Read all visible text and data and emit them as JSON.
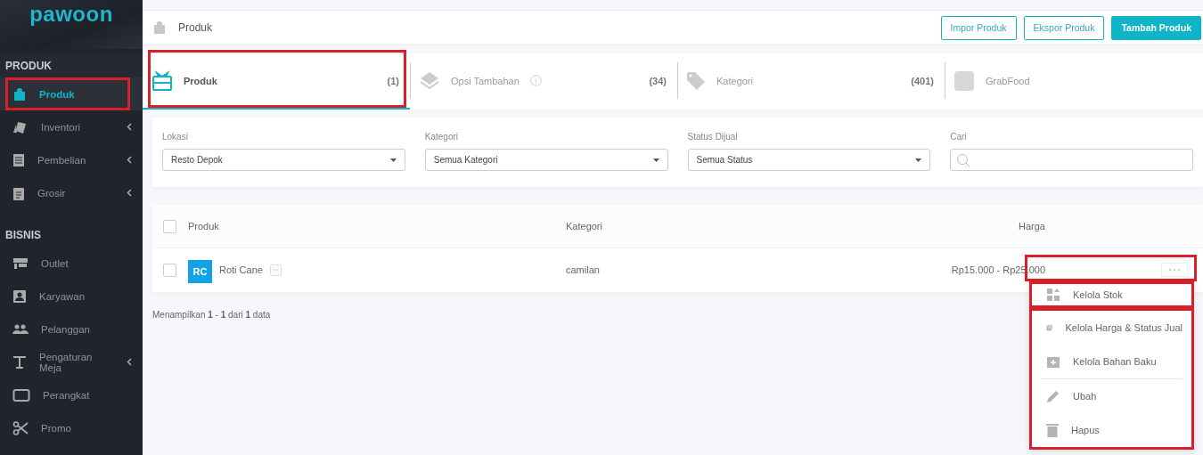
{
  "sidebar": {
    "logo": "pawoon",
    "sections": [
      {
        "title": "PRODUK",
        "items": [
          {
            "label": "Produk",
            "selected": true,
            "highlighted": true,
            "has_submenu": false
          },
          {
            "label": "Inventori",
            "selected": false,
            "highlighted": false,
            "has_submenu": true
          },
          {
            "label": "Pembelian",
            "selected": false,
            "highlighted": false,
            "has_submenu": true
          },
          {
            "label": "Grosir",
            "selected": false,
            "highlighted": false,
            "has_submenu": true
          }
        ]
      },
      {
        "title": "BISNIS",
        "items": [
          {
            "label": "Outlet",
            "selected": false,
            "highlighted": false,
            "has_submenu": false
          },
          {
            "label": "Karyawan",
            "selected": false,
            "highlighted": false,
            "has_submenu": false
          },
          {
            "label": "Pelanggan",
            "selected": false,
            "highlighted": false,
            "has_submenu": false
          },
          {
            "label": "Pengaturan Meja",
            "selected": false,
            "highlighted": false,
            "has_submenu": true
          },
          {
            "label": "Perangkat",
            "selected": false,
            "highlighted": false,
            "has_submenu": false
          },
          {
            "label": "Promo",
            "selected": false,
            "highlighted": false,
            "has_submenu": false
          }
        ]
      }
    ]
  },
  "header": {
    "title": "Produk",
    "buttons": [
      {
        "label": "Impor Produk",
        "kind": "outline"
      },
      {
        "label": "Ekspor Produk",
        "kind": "outline"
      },
      {
        "label": "Tambah Produk",
        "kind": "primary"
      }
    ]
  },
  "tabs": [
    {
      "label": "Produk",
      "count": "(1)",
      "selected": true,
      "highlighted": true,
      "info": false
    },
    {
      "label": "Opsi Tambahan",
      "count": "(34)",
      "selected": false,
      "highlighted": false,
      "info": true
    },
    {
      "label": "Kategori",
      "count": "(401)",
      "selected": false,
      "highlighted": false,
      "info": false
    },
    {
      "label": "GrabFood",
      "selected": false,
      "highlighted": false,
      "info": false
    }
  ],
  "filters": [
    {
      "label": "Lokasi",
      "kind": "select",
      "value": "Resto Depok"
    },
    {
      "label": "Kategori",
      "kind": "select",
      "value": "Semua Kategori"
    },
    {
      "label": "Status Dijual",
      "kind": "select",
      "value": "Semua Status"
    },
    {
      "label": "Cari",
      "kind": "search"
    }
  ],
  "table": {
    "columns": [
      "Produk",
      "Kategori",
      "Harga"
    ],
    "header_checked": false,
    "rows": [
      {
        "checked": false,
        "initials": "RC",
        "name": "Roti Cane",
        "category": "camilan",
        "price": "Rp15.000 - Rp25.000",
        "highlighted": true
      }
    ]
  },
  "summary": "Menampilkan **1** - **1** dari **1** data",
  "menu": {
    "sections": [
      {
        "highlighted": true,
        "groups": [
          [
            "Kelola Stok"
          ]
        ]
      },
      {
        "highlighted": true,
        "groups": [
          [
            "Kelola Harga & Status Jual",
            "Kelola Bahan Baku"
          ],
          [
            "Ubah",
            "Hapus"
          ]
        ]
      }
    ]
  }
}
